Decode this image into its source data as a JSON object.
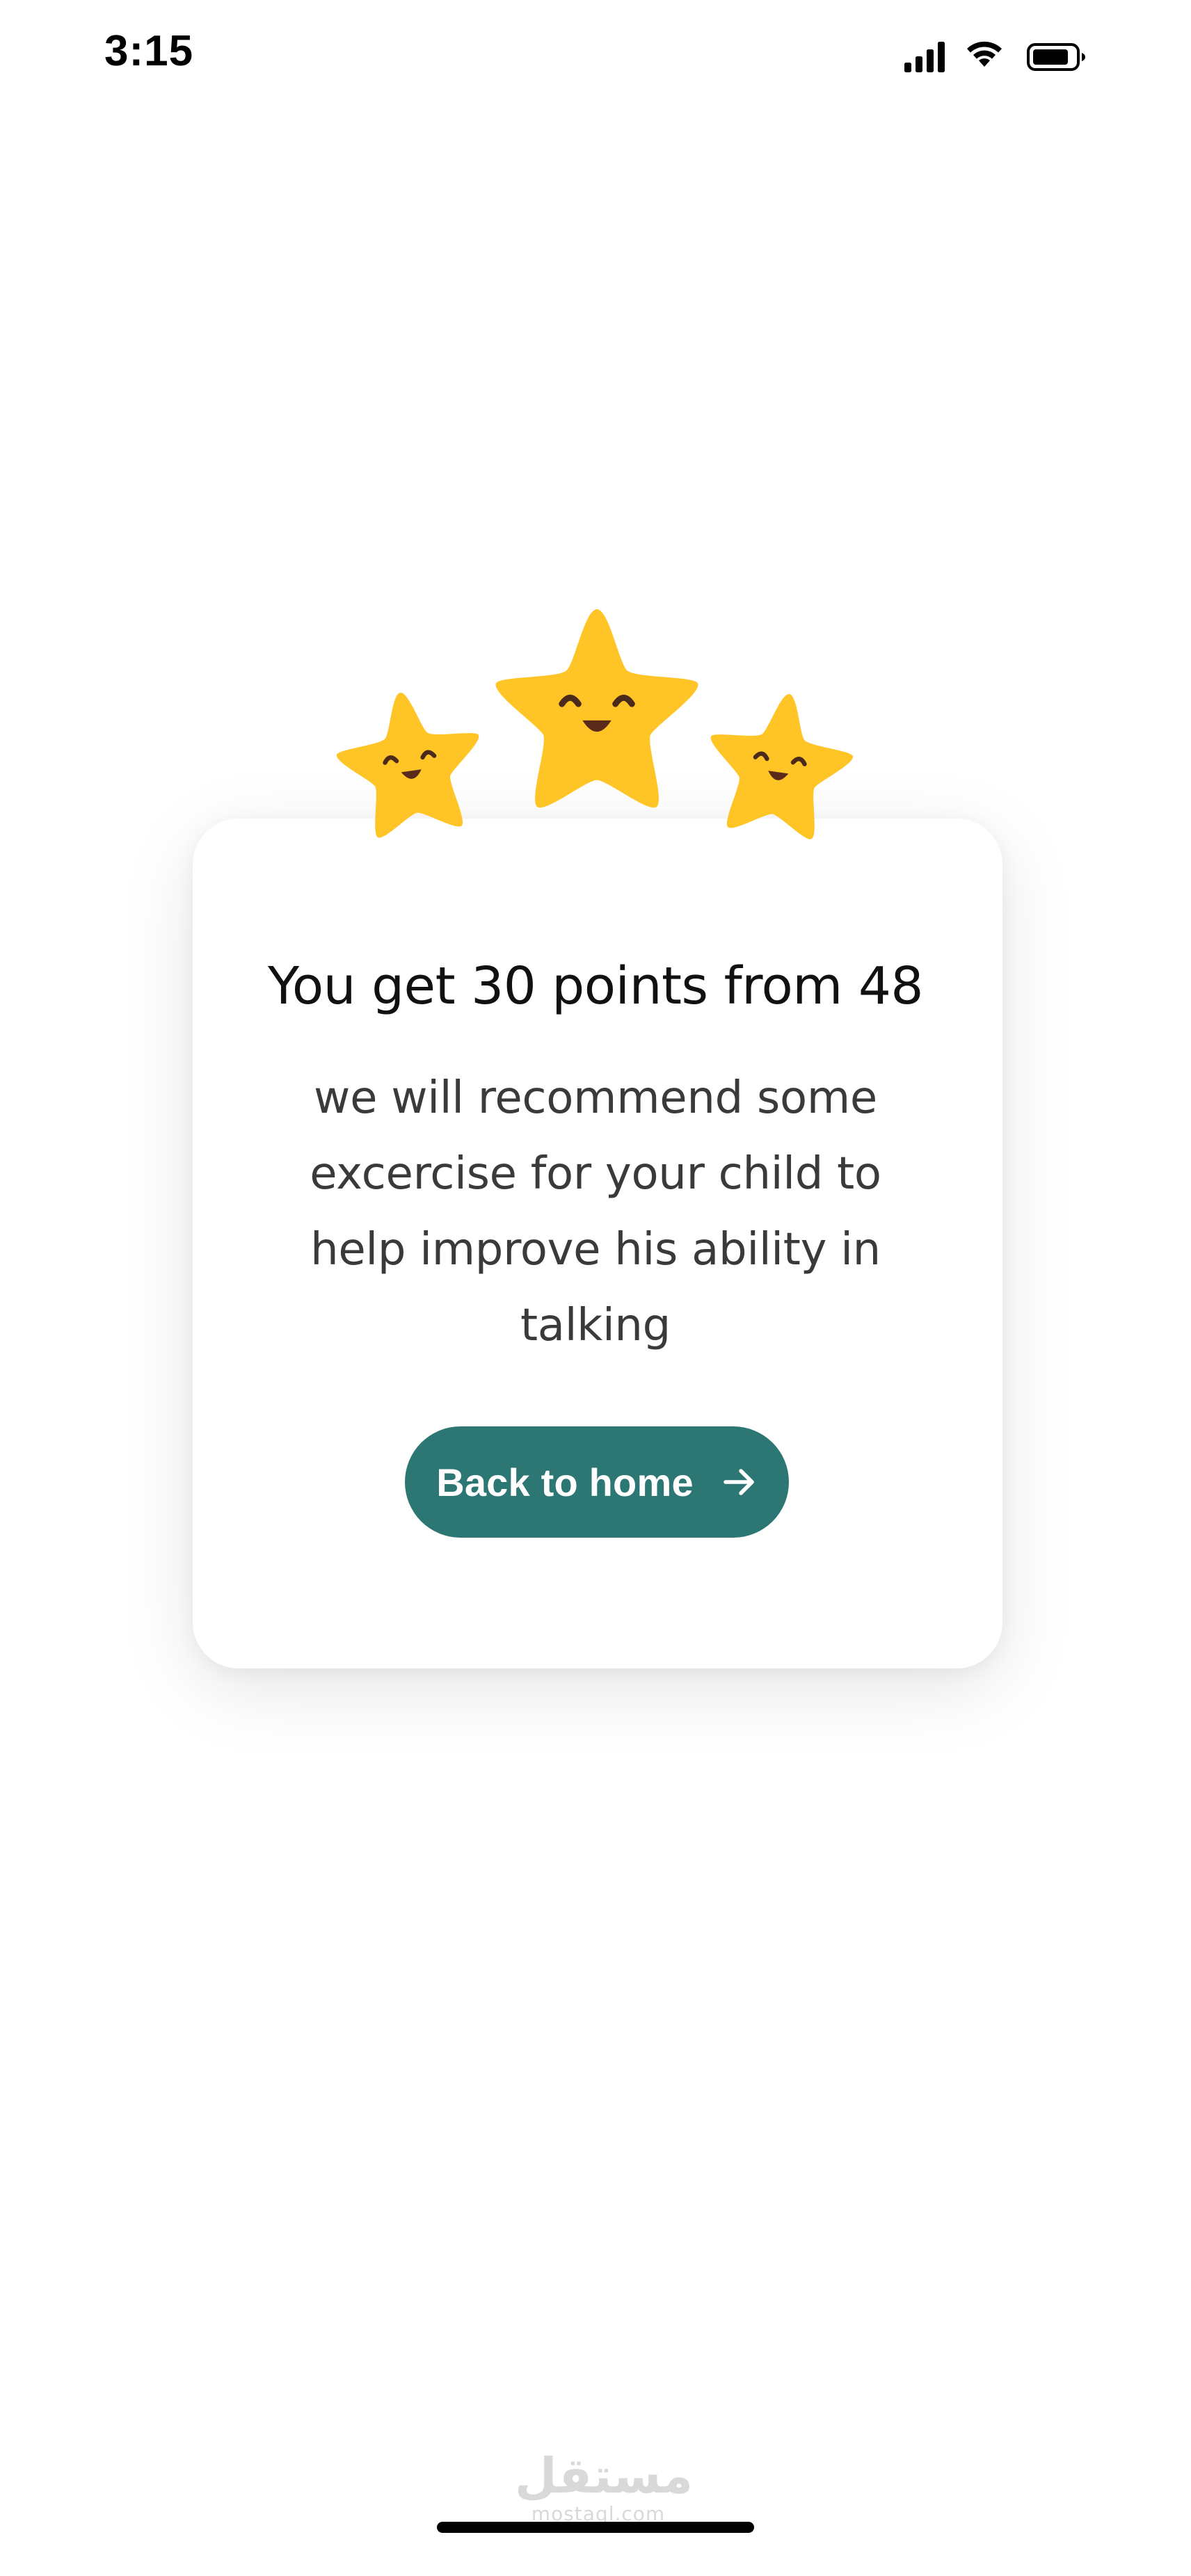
{
  "status_bar": {
    "time": "3:15",
    "icons": [
      "cellular-signal-icon",
      "wifi-icon",
      "battery-icon"
    ]
  },
  "result_card": {
    "stars_count": 3,
    "star_color": "#FFC425",
    "title": "You get 30 points from 48",
    "message": "we will recommend some excercise  for your child to help improve his ability in talking",
    "button": {
      "label": "Back to home",
      "icon": "arrow-right-icon",
      "color": "#2C7773"
    }
  },
  "watermark": {
    "arabic": "مستقل",
    "latin": "mostaql.com"
  }
}
